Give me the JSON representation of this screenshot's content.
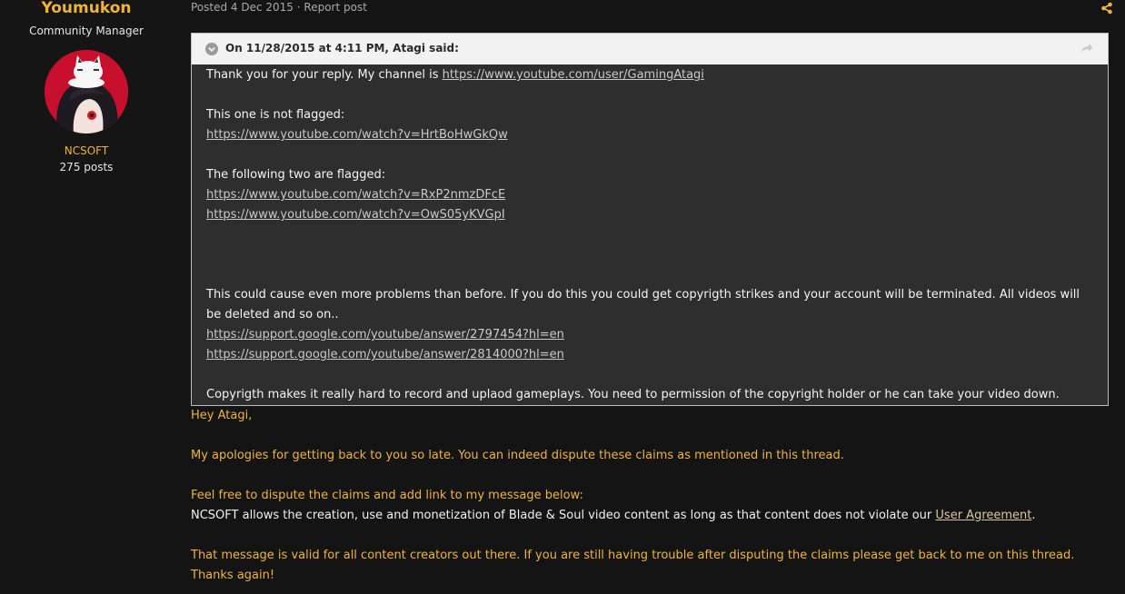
{
  "author": {
    "name": "Youmukon",
    "title": "Community Manager",
    "group": "NCSOFT",
    "posts": "275 posts"
  },
  "post_meta": {
    "posted": "Posted 4 Dec 2015",
    "separator": " · ",
    "report": "Report post",
    "share_icon": "share-icon"
  },
  "quote": {
    "citation": "On 11/28/2015 at 4:11 PM, Atagi said:",
    "line1_text": "Thank you for your reply. My channel is ",
    "line1_link": "https://www.youtube.com/user/GamingAtagi",
    "not_flagged_label": "This one is not flagged:",
    "not_flagged_link": "https://www.youtube.com/watch?v=HrtBoHwGkQw",
    "flagged_label": "The following two are flagged:",
    "flagged_link1": "https://www.youtube.com/watch?v=RxP2nmzDFcE",
    "flagged_link2": "https://www.youtube.com/watch?v=OwS05yKVGpI",
    "problems_text": "This could cause even more problems than before. If you do this you could get copyrigth strikes and your account will be terminated. All videos will be deleted and so on..",
    "support_link1": "https://support.google.com/youtube/answer/2797454?hl=en",
    "support_link2": "https://support.google.com/youtube/answer/2814000?hl=en",
    "copyright_text": "Copyrigth makes it really hard to record and uplaod gameplays. You need to permission of the copyright holder or he can take your video down."
  },
  "reply": {
    "greeting": "Hey Atagi,",
    "apology": "My apologies for getting back to you so late. You can indeed dispute these claims as mentioned in this thread.",
    "dispute": "Feel free to dispute the claims and add link to my message below:",
    "ncsoft_text": "NCSOFT allows the creation, use and monetization of Blade & Soul video content as long as that content does not violate our ",
    "ua_link": "User Agreement",
    "ua_period": ".",
    "valid": "That message is valid for all content creators out there. If you are still having trouble after disputing the claims please get back to me on this thread. Thanks again!"
  },
  "colors": {
    "accent": "#f0b43a",
    "background": "#141414",
    "quote_bg": "#2e2e2e",
    "quote_header_bg": "#f2f2f2"
  }
}
